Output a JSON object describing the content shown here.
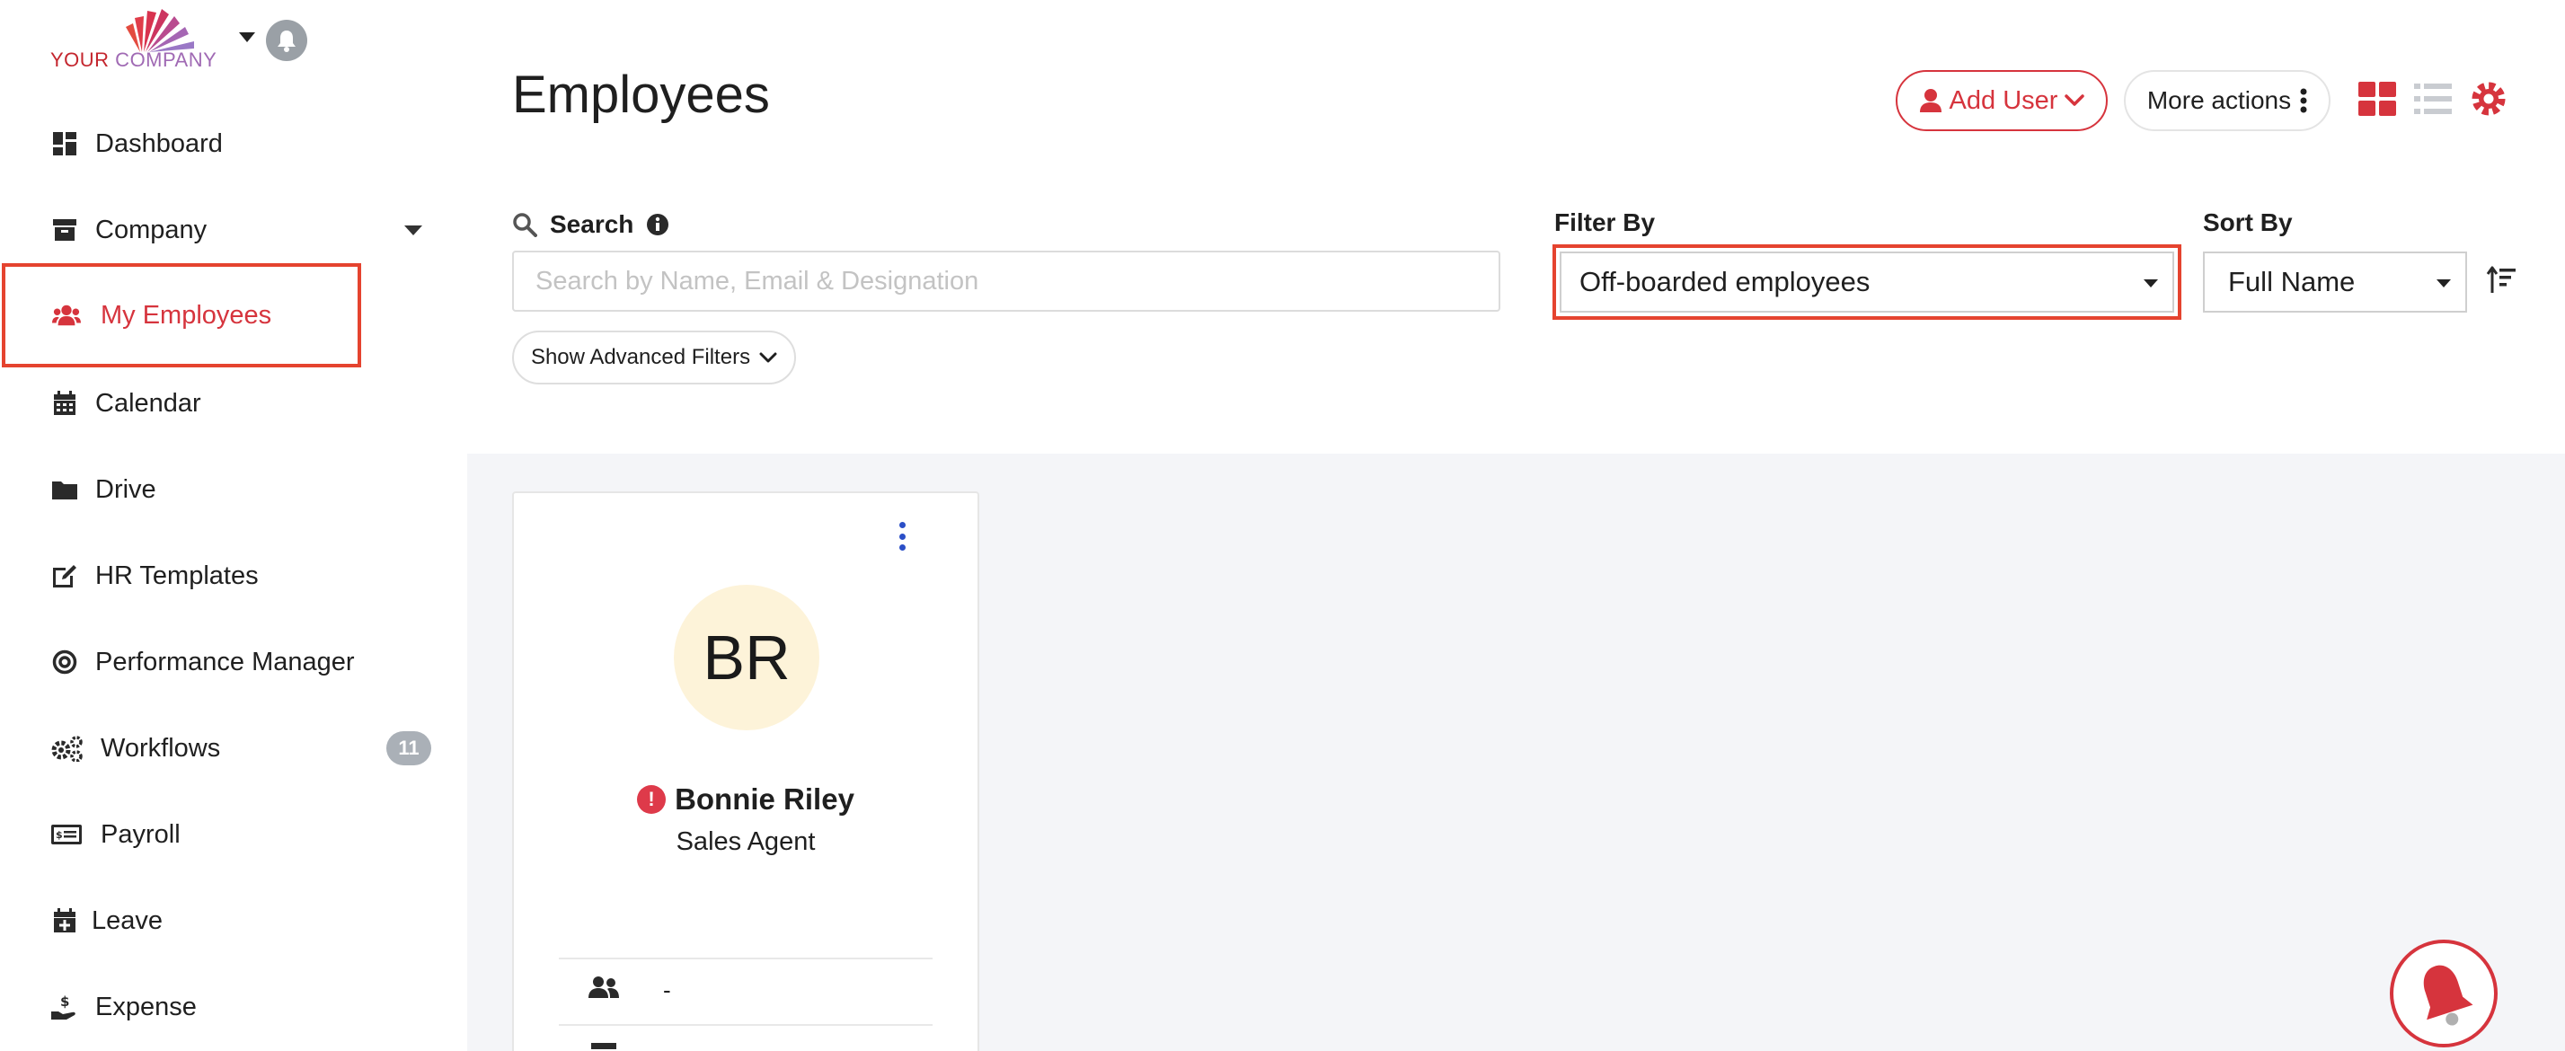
{
  "brand": {
    "logo_text_your": "YOUR",
    "logo_text_company": " COMPANY",
    "accent_color": "#d6343d",
    "highlight_color": "#e5432f"
  },
  "sidebar": {
    "items": [
      {
        "label": "Dashboard",
        "icon": "dashboard-icon"
      },
      {
        "label": "Company",
        "icon": "company-icon"
      },
      {
        "label": "My Employees",
        "icon": "users-icon",
        "active": true
      },
      {
        "label": "Calendar",
        "icon": "calendar-icon"
      },
      {
        "label": "Drive",
        "icon": "folder-icon"
      },
      {
        "label": "HR Templates",
        "icon": "edit-icon"
      },
      {
        "label": "Performance Manager",
        "icon": "target-icon"
      },
      {
        "label": "Workflows",
        "icon": "cogs-icon",
        "badge": "11"
      },
      {
        "label": "Payroll",
        "icon": "money-icon"
      },
      {
        "label": "Leave",
        "icon": "calendar-plus-icon"
      },
      {
        "label": "Expense",
        "icon": "hand-money-icon"
      }
    ]
  },
  "header": {
    "title": "Employees",
    "add_user_label": "Add User",
    "more_actions_label": "More actions"
  },
  "search": {
    "label": "Search",
    "placeholder": "Search by Name, Email & Designation",
    "value": "",
    "advanced_filters_label": "Show Advanced Filters"
  },
  "filter": {
    "label": "Filter By",
    "selected": "Off-boarded employees"
  },
  "sort": {
    "label": "Sort By",
    "selected": "Full Name"
  },
  "employees": [
    {
      "initials": "BR",
      "name": "Bonnie Riley",
      "title": "Sales Agent",
      "team": "-"
    }
  ]
}
